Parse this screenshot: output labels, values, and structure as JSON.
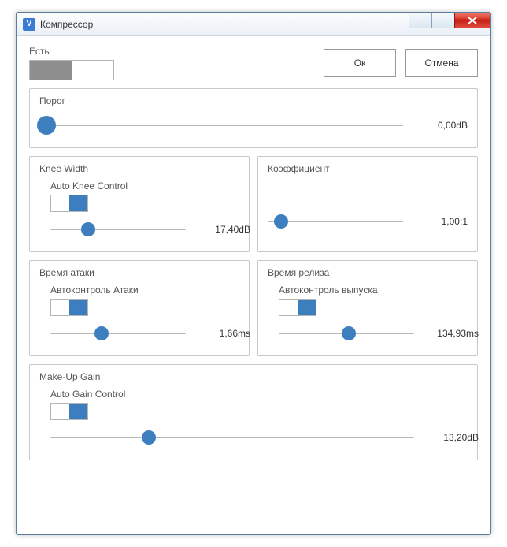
{
  "titlebar": {
    "title": "Компрессор"
  },
  "enable": {
    "label": "Есть"
  },
  "buttons": {
    "ok": "Ок",
    "cancel": "Отмена"
  },
  "threshold": {
    "label": "Порог",
    "value": "0,00dB",
    "pos": 2
  },
  "kneeWidth": {
    "label": "Knee Width",
    "autoLabel": "Auto Knee Control",
    "value": "17,40dB",
    "pos": 28
  },
  "ratio": {
    "label": "Коэффициент",
    "value": "1,00:1",
    "pos": 10
  },
  "attack": {
    "label": "Время атаки",
    "autoLabel": "Автоконтроль Атаки",
    "value": "1,66ms",
    "pos": 38
  },
  "release": {
    "label": "Время релиза",
    "autoLabel": "Автоконтроль выпуска",
    "value": "134,93ms",
    "pos": 52
  },
  "makeup": {
    "label": "Make-Up Gain",
    "autoLabel": "Auto Gain Control",
    "value": "13,20dB",
    "pos": 27
  }
}
